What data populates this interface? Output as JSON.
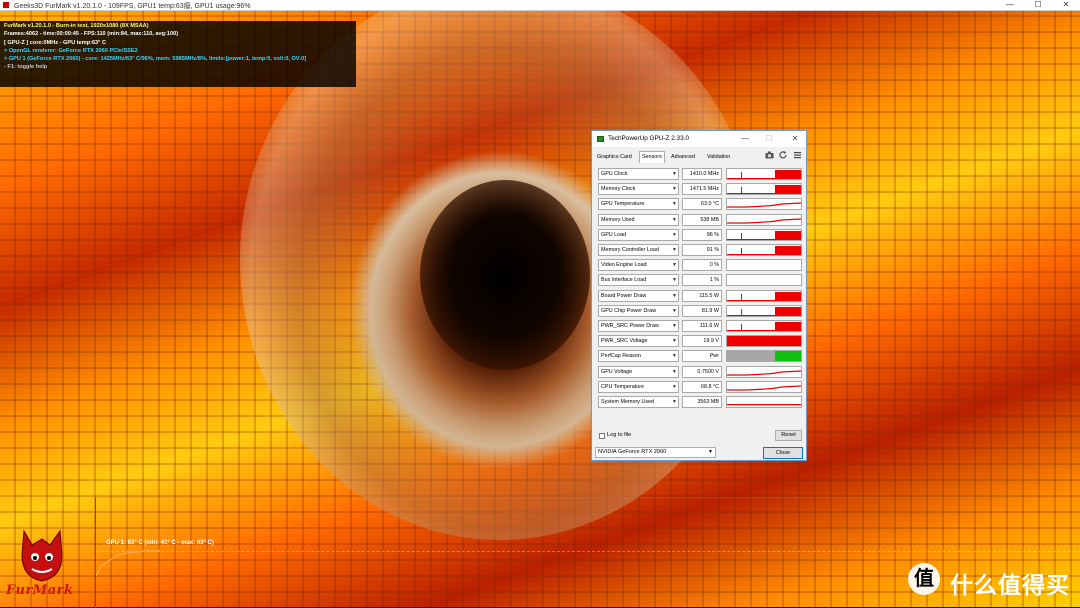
{
  "titlebar": {
    "text": "Geeks3D FurMark v1.20.1.0 - 109FPS, GPU1 temp:63癈, GPU1 usage:96%",
    "minimize": "—",
    "maximize": "☐",
    "close": "✕"
  },
  "osd": {
    "line1": "FurMark v1.20.1.0 - Burn-in test, 1920x1080 (8X MSAA)",
    "line2": "Frames:4062 - time:00:00:45 - FPS:110 (min:84, max:110, avg:100)",
    "line3": "[ GPU-Z ] core:0MHz - GPU temp:63° C",
    "line4": "> OpenGL renderer: GeForce RTX 2060 PCIe/SSE2",
    "line5": "> GPU 1 (GeForce RTX 2060) - core: 1425MHz/63° C/96%, mem: 5985MHz/8%, limits:[power:1, temp:0, volt:0, OV:0]",
    "line6": "- F1: toggle help"
  },
  "temp_graph": {
    "label": "GPU 1: 63° C (min: 41° C - max: 63° C)",
    "line_color": "#ffaa55"
  },
  "logos": {
    "furmark": "FurMark",
    "smzdm_icon": "值",
    "smzdm_text": "什么值得买"
  },
  "gpuz": {
    "title": "TechPowerUp GPU-Z 2.33.0",
    "window_buttons": {
      "minimize": "—",
      "maximize": "☐",
      "close": "✕"
    },
    "tabs": [
      "Graphics Card",
      "Sensors",
      "Advanced",
      "Validation"
    ],
    "active_tab": "Sensors",
    "toolbar_icons": [
      "camera-icon",
      "refresh-icon",
      "menu-icon"
    ],
    "sensors": [
      {
        "name": "GPU Clock",
        "value": "1410.0 MHz",
        "graph": "high"
      },
      {
        "name": "Memory Clock",
        "value": "1471.5 MHz",
        "graph": "high"
      },
      {
        "name": "GPU Temperature",
        "value": "63.0 °C",
        "graph": "low"
      },
      {
        "name": "Memory Used",
        "value": "538 MB",
        "graph": "low"
      },
      {
        "name": "GPU Load",
        "value": "96 %",
        "graph": "high"
      },
      {
        "name": "Memory Controller Load",
        "value": "91 %",
        "graph": "high"
      },
      {
        "name": "Video Engine Load",
        "value": "0 %",
        "graph": "none"
      },
      {
        "name": "Bus Interface Load",
        "value": "1 %",
        "graph": "none"
      },
      {
        "name": "Board Power Draw",
        "value": "115.5 W",
        "graph": "high"
      },
      {
        "name": "GPU Chip Power Draw",
        "value": "81.9 W",
        "graph": "high"
      },
      {
        "name": "PWR_SRC Power Draw",
        "value": "111.6 W",
        "graph": "high"
      },
      {
        "name": "PWR_SRC Voltage",
        "value": "19.9 V",
        "graph": "full"
      },
      {
        "name": "PerfCap Reason",
        "value": "Pwr",
        "graph": "perfcap"
      },
      {
        "name": "GPU Voltage",
        "value": "0.7500 V",
        "graph": "low"
      },
      {
        "name": "CPU Temperature",
        "value": "68.8 °C",
        "graph": "low"
      },
      {
        "name": "System Memory Used",
        "value": "3563 MB",
        "graph": "flat"
      }
    ],
    "log_to_file": "Log to file",
    "reset": "Reset",
    "device": "NVIDIA GeForce RTX 2060",
    "close": "Close"
  },
  "colors": {
    "graph_red": "#ee0000",
    "perfcap_gray": "#a6a6a6",
    "perfcap_green": "#10c010",
    "window_border": "#6b9bd1"
  }
}
